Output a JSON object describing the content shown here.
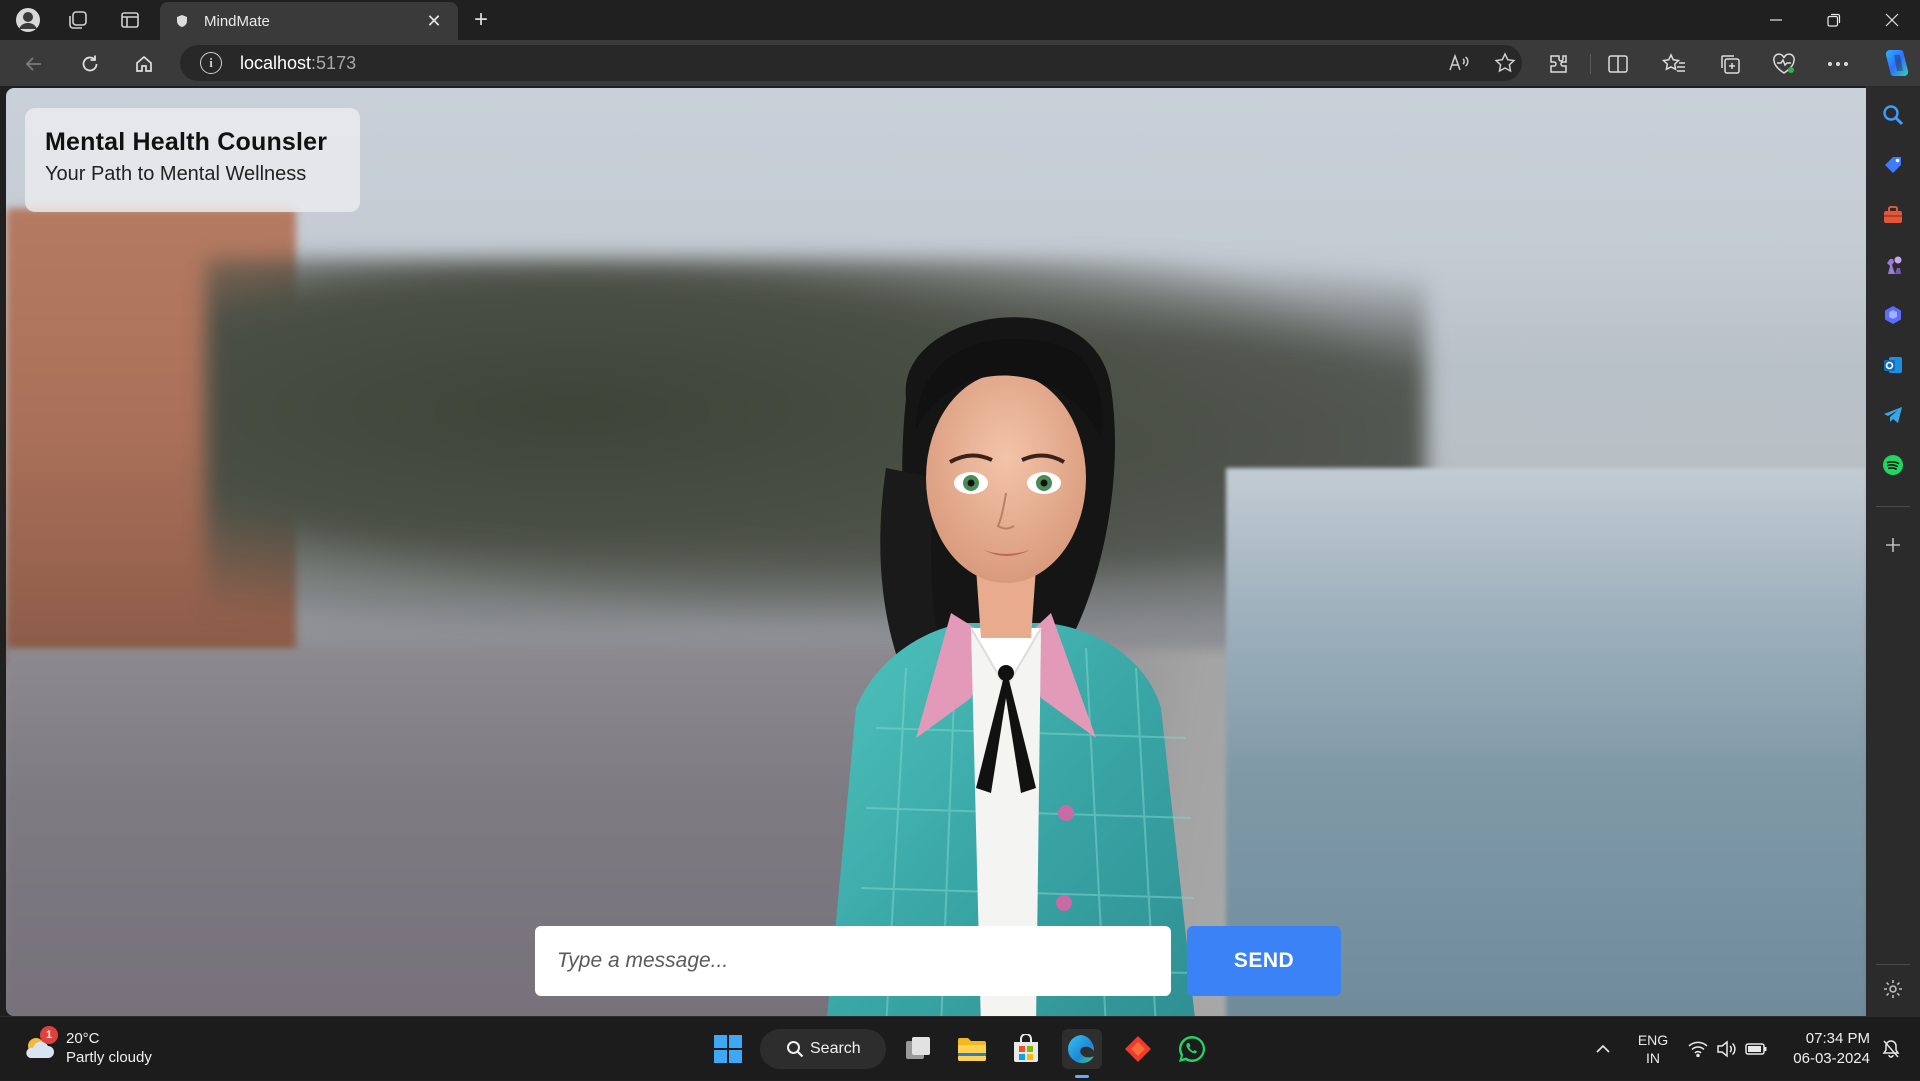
{
  "browser": {
    "tab_title": "MindMate",
    "url_host": "localhost",
    "url_port": ":5173"
  },
  "page": {
    "title": "Mental Health Counsler",
    "subtitle": "Your Path to Mental Wellness",
    "input_placeholder": "Type a message...",
    "send_label": "SEND"
  },
  "taskbar": {
    "weather_temp": "20°C",
    "weather_desc": "Partly cloudy",
    "weather_badge": "1",
    "search_label": "Search",
    "lang_line1": "ENG",
    "lang_line2": "IN",
    "time": "07:34 PM",
    "date": "06-03-2024"
  },
  "colors": {
    "send_button": "#3b82f6",
    "browser_frame": "#202020",
    "toolbar": "#3a3a3a"
  }
}
